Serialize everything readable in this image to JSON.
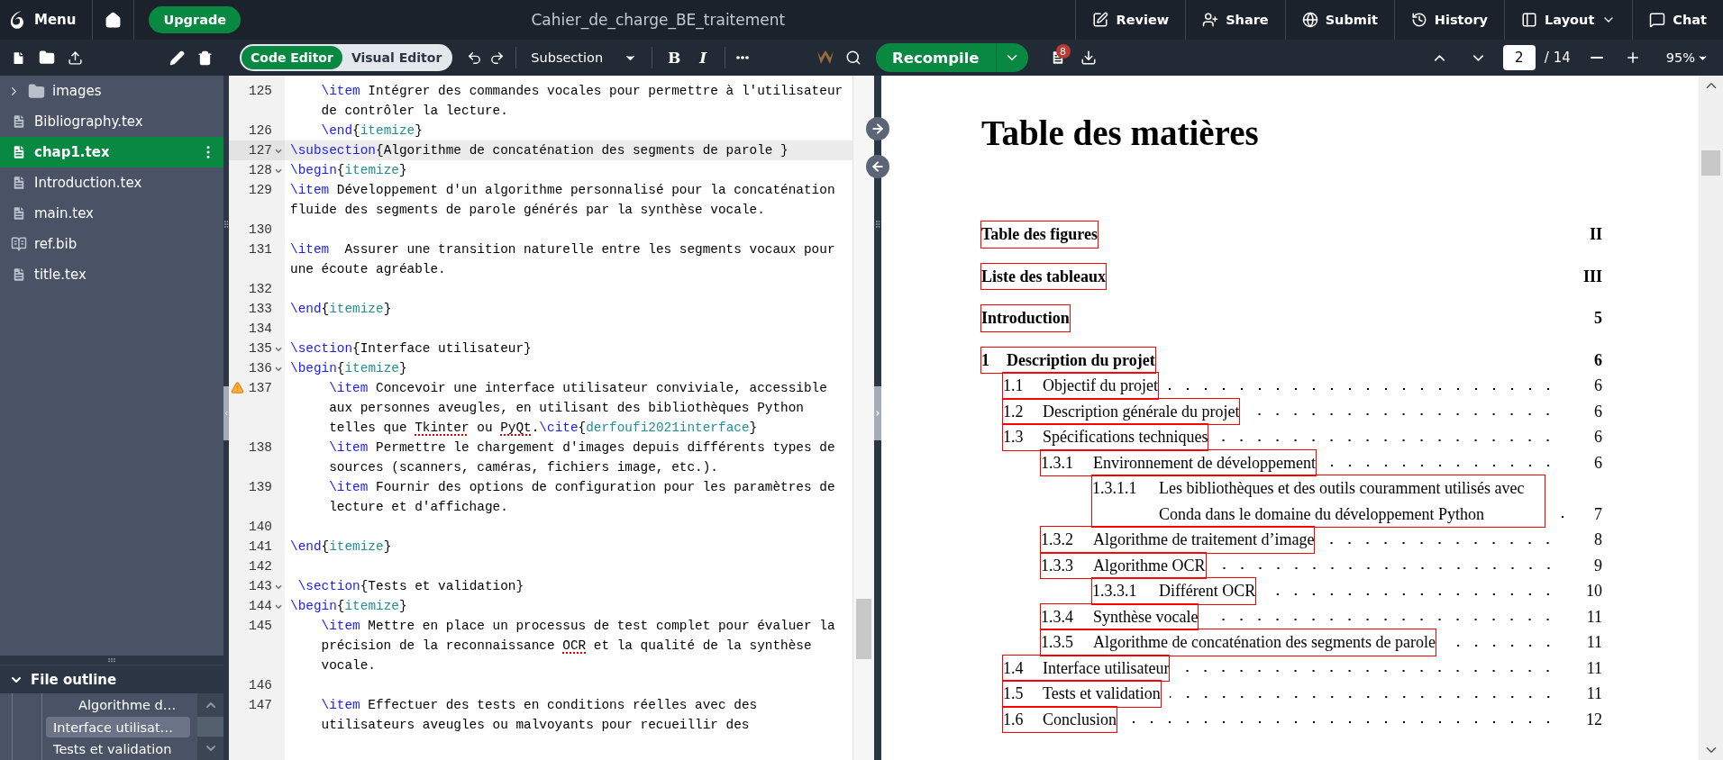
{
  "top_bar": {
    "menu_label": "Menu",
    "upgrade_label": "Upgrade",
    "project_title": "Cahier_de_charge_BE_traitement",
    "actions": [
      {
        "kind": "review",
        "label": "Review"
      },
      {
        "kind": "share",
        "label": "Share"
      },
      {
        "kind": "submit",
        "label": "Submit"
      },
      {
        "kind": "history",
        "label": "History"
      },
      {
        "kind": "layout",
        "label": "Layout",
        "has_menu": true
      },
      {
        "kind": "chat",
        "label": "Chat"
      }
    ]
  },
  "editor_toolbar": {
    "modes": [
      {
        "label": "Code Editor",
        "selected": true
      },
      {
        "label": "Visual Editor",
        "selected": false
      }
    ],
    "style_select": "Subsection",
    "format_buttons": [
      {
        "kind": "bold",
        "label": "B"
      },
      {
        "kind": "italic",
        "label": "I"
      }
    ]
  },
  "pdf_toolbar": {
    "recompile_label": "Recompile",
    "log_badge": "8",
    "page_value": "2",
    "page_total": "/ 14",
    "zoom": "95%"
  },
  "file_tree": [
    {
      "kind": "folder",
      "name": "images",
      "expanded": false,
      "selected": false
    },
    {
      "kind": "file",
      "name": "Bibliography.tex",
      "selected": false
    },
    {
      "kind": "file",
      "name": "chap1.tex",
      "selected": true
    },
    {
      "kind": "file",
      "name": "Introduction.tex",
      "selected": false
    },
    {
      "kind": "file",
      "name": "main.tex",
      "selected": false
    },
    {
      "kind": "bib",
      "name": "ref.bib",
      "selected": false
    },
    {
      "kind": "file",
      "name": "title.tex",
      "selected": false
    }
  ],
  "file_outline": {
    "title": "File outline",
    "expanded": true,
    "items": [
      {
        "kind": "subsection",
        "label": "Algorithme d…",
        "selected": false
      },
      {
        "kind": "section",
        "label": "Interface utilisat…",
        "selected": true
      },
      {
        "kind": "section",
        "label": "Tests et validation",
        "selected": false
      }
    ]
  },
  "code": {
    "lines": [
      {
        "number": "125",
        "fold": false,
        "warning": false,
        "active": false,
        "segments": [
          {
            "kind": "cmd",
            "text": "    \\item"
          },
          {
            "kind": "text",
            "text": " Intégrer des commandes vocales pour permettre à l'utilisateur de contrôler la lecture."
          }
        ]
      },
      {
        "number": "126",
        "fold": false,
        "warning": false,
        "active": false,
        "segments": [
          {
            "kind": "cmd",
            "text": "    \\end"
          },
          {
            "kind": "text",
            "text": "{"
          },
          {
            "kind": "arg",
            "text": "itemize"
          },
          {
            "kind": "text",
            "text": "}"
          }
        ]
      },
      {
        "number": "127",
        "fold": true,
        "warning": false,
        "active": true,
        "segments": [
          {
            "kind": "cmd",
            "text": "\\subsection"
          },
          {
            "kind": "text",
            "text": "{Algorithme de concaténation des segments de parole }"
          }
        ]
      },
      {
        "number": "128",
        "fold": true,
        "warning": false,
        "active": false,
        "segments": [
          {
            "kind": "cmd",
            "text": "\\begin"
          },
          {
            "kind": "text",
            "text": "{"
          },
          {
            "kind": "arg",
            "text": "itemize"
          },
          {
            "kind": "text",
            "text": "}"
          }
        ]
      },
      {
        "number": "129",
        "fold": false,
        "warning": false,
        "active": false,
        "segments": [
          {
            "kind": "cmd",
            "text": "\\item"
          },
          {
            "kind": "text",
            "text": " Développement d'un algorithme personnalisé pour la concaténation fluide des segments de parole générés par la synthèse vocale."
          }
        ]
      },
      {
        "number": "130",
        "fold": false,
        "warning": false,
        "active": false
      },
      {
        "number": "131",
        "fold": false,
        "warning": false,
        "active": false,
        "segments": [
          {
            "kind": "cmd",
            "text": "\\item"
          },
          {
            "kind": "text",
            "text": "  Assurer une transition naturelle entre les segments vocaux pour une écoute agréable."
          }
        ]
      },
      {
        "number": "132",
        "fold": false,
        "warning": false,
        "active": false
      },
      {
        "number": "133",
        "fold": false,
        "warning": false,
        "active": false,
        "segments": [
          {
            "kind": "cmd",
            "text": "\\end"
          },
          {
            "kind": "text",
            "text": "{"
          },
          {
            "kind": "arg",
            "text": "itemize"
          },
          {
            "kind": "text",
            "text": "}"
          }
        ]
      },
      {
        "number": "134",
        "fold": false,
        "warning": false,
        "active": false
      },
      {
        "number": "135",
        "fold": true,
        "warning": false,
        "active": false,
        "segments": [
          {
            "kind": "cmd",
            "text": "\\section"
          },
          {
            "kind": "text",
            "text": "{Interface utilisateur}"
          }
        ]
      },
      {
        "number": "136",
        "fold": true,
        "warning": false,
        "active": false,
        "segments": [
          {
            "kind": "cmd",
            "text": "\\begin"
          },
          {
            "kind": "text",
            "text": "{"
          },
          {
            "kind": "arg",
            "text": "itemize"
          },
          {
            "kind": "text",
            "text": "}"
          }
        ]
      },
      {
        "number": "137",
        "fold": false,
        "warning": true,
        "active": false,
        "segments": [
          {
            "kind": "cmd",
            "text": "     \\item"
          },
          {
            "kind": "text",
            "text": " Concevoir une interface utilisateur conviviale, accessible aux personnes aveugles, en utilisant des bibliothèques Python telles que "
          },
          {
            "kind": "misspelled",
            "text": "Tkinter"
          },
          {
            "kind": "text",
            "text": " ou "
          },
          {
            "kind": "misspelled",
            "text": "PyQt"
          },
          {
            "kind": "text",
            "text": "."
          },
          {
            "kind": "cmd",
            "text": "\\cite"
          },
          {
            "kind": "text",
            "text": "{"
          },
          {
            "kind": "arg",
            "text": "derfoufi2021interface"
          },
          {
            "kind": "text",
            "text": "}"
          }
        ]
      },
      {
        "number": "138",
        "fold": false,
        "warning": false,
        "active": false,
        "segments": [
          {
            "kind": "cmd",
            "text": "     \\item"
          },
          {
            "kind": "text",
            "text": " Permettre le chargement d'images depuis différents types de sources (scanners, caméras, fichiers image, etc.)."
          }
        ]
      },
      {
        "number": "139",
        "fold": false,
        "warning": false,
        "active": false,
        "segments": [
          {
            "kind": "cmd",
            "text": "     \\item"
          },
          {
            "kind": "text",
            "text": " Fournir des options de configuration pour les paramètres de lecture et d'affichage."
          }
        ]
      },
      {
        "number": "140",
        "fold": false,
        "warning": false,
        "active": false
      },
      {
        "number": "141",
        "fold": false,
        "warning": false,
        "active": false,
        "segments": [
          {
            "kind": "cmd",
            "text": "\\end"
          },
          {
            "kind": "text",
            "text": "{"
          },
          {
            "kind": "arg",
            "text": "itemize"
          },
          {
            "kind": "text",
            "text": "}"
          }
        ]
      },
      {
        "number": "142",
        "fold": false,
        "warning": false,
        "active": false
      },
      {
        "number": "143",
        "fold": true,
        "warning": false,
        "active": false,
        "segments": [
          {
            "kind": "cmd",
            "text": " \\section"
          },
          {
            "kind": "text",
            "text": "{Tests et validation}"
          }
        ]
      },
      {
        "number": "144",
        "fold": true,
        "warning": false,
        "active": false,
        "segments": [
          {
            "kind": "cmd",
            "text": "\\begin"
          },
          {
            "kind": "text",
            "text": "{"
          },
          {
            "kind": "arg",
            "text": "itemize"
          },
          {
            "kind": "text",
            "text": "}"
          }
        ]
      },
      {
        "number": "145",
        "fold": false,
        "warning": false,
        "active": false,
        "segments": [
          {
            "kind": "cmd",
            "text": "    \\item"
          },
          {
            "kind": "text",
            "text": " Mettre en place un processus de test complet pour évaluer la précision de la reconnaissance "
          },
          {
            "kind": "misspelled",
            "text": "OCR"
          },
          {
            "kind": "text",
            "text": " et la qualité de la synthèse vocale."
          }
        ]
      },
      {
        "number": "146",
        "fold": false,
        "warning": false,
        "active": false
      },
      {
        "number": "147",
        "fold": false,
        "warning": false,
        "active": false,
        "segments": [
          {
            "kind": "cmd",
            "text": "    \\item"
          },
          {
            "kind": "text",
            "text": " Effectuer des tests en conditions réelles avec des utilisateurs aveugles ou malvoyants pour recueillir des"
          }
        ]
      }
    ]
  },
  "pdf": {
    "heading": "Table des matières",
    "toc": [
      {
        "kind": "chapter",
        "title": "Table des figures",
        "page": "II"
      },
      {
        "kind": "chapter",
        "title": "Liste des tableaux",
        "page": "III"
      },
      {
        "kind": "chapter",
        "title": "Introduction",
        "page": "5"
      },
      {
        "kind": "chapter",
        "number": "1",
        "title": "Description du projet",
        "page": "6"
      },
      {
        "kind": "section",
        "number": "1.1",
        "title": "Objectif du projet",
        "page": "6"
      },
      {
        "kind": "section",
        "number": "1.2",
        "title": "Description générale du projet",
        "page": "6"
      },
      {
        "kind": "section",
        "number": "1.3",
        "title": "Spécifications techniques",
        "page": "6"
      },
      {
        "kind": "subsection",
        "number": "1.3.1",
        "title": "Environnement de développement",
        "page": "6"
      },
      {
        "kind": "subsubsection",
        "number": "1.3.1.1",
        "title": "Les bibliothèques et des outils couramment utilisés avec Conda dans le domaine du développement Python",
        "page": "7"
      },
      {
        "kind": "subsection",
        "number": "1.3.2",
        "title": "Algorithme de traitement d’image",
        "page": "8"
      },
      {
        "kind": "subsection",
        "number": "1.3.3",
        "title": "Algorithme OCR",
        "page": "9"
      },
      {
        "kind": "subsubsection",
        "number": "1.3.3.1",
        "title": "Différent OCR",
        "page": "10"
      },
      {
        "kind": "subsection",
        "number": "1.3.4",
        "title": "Synthèse vocale",
        "page": "11"
      },
      {
        "kind": "subsection",
        "number": "1.3.5",
        "title": "Algorithme de concaténation des segments de parole",
        "page": "11"
      },
      {
        "kind": "section",
        "number": "1.4",
        "title": "Interface utilisateur",
        "page": "11"
      },
      {
        "kind": "section",
        "number": "1.5",
        "title": "Tests et validation",
        "page": "11"
      },
      {
        "kind": "section",
        "number": "1.6",
        "title": "Conclusion",
        "page": "12"
      }
    ]
  }
}
